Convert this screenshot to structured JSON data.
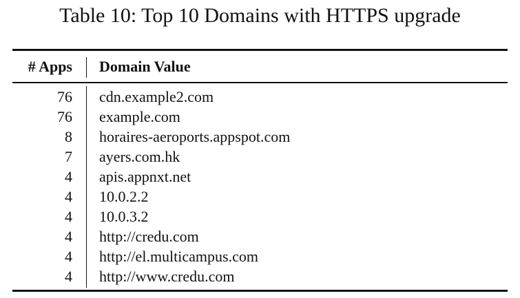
{
  "caption": "Table 10: Top 10 Domains with HTTPS upgrade",
  "table": {
    "headers": {
      "apps": "# Apps",
      "domain": "Domain Value"
    },
    "rows": [
      {
        "apps": "76",
        "domain": "cdn.example2.com"
      },
      {
        "apps": "76",
        "domain": "example.com"
      },
      {
        "apps": "8",
        "domain": "horaires-aeroports.appspot.com"
      },
      {
        "apps": "7",
        "domain": "ayers.com.hk"
      },
      {
        "apps": "4",
        "domain": "apis.appnxt.net"
      },
      {
        "apps": "4",
        "domain": "10.0.2.2"
      },
      {
        "apps": "4",
        "domain": "10.0.3.2"
      },
      {
        "apps": "4",
        "domain": "http://credu.com"
      },
      {
        "apps": "4",
        "domain": "http://el.multicampus.com"
      },
      {
        "apps": "4",
        "domain": "http://www.credu.com"
      }
    ]
  }
}
